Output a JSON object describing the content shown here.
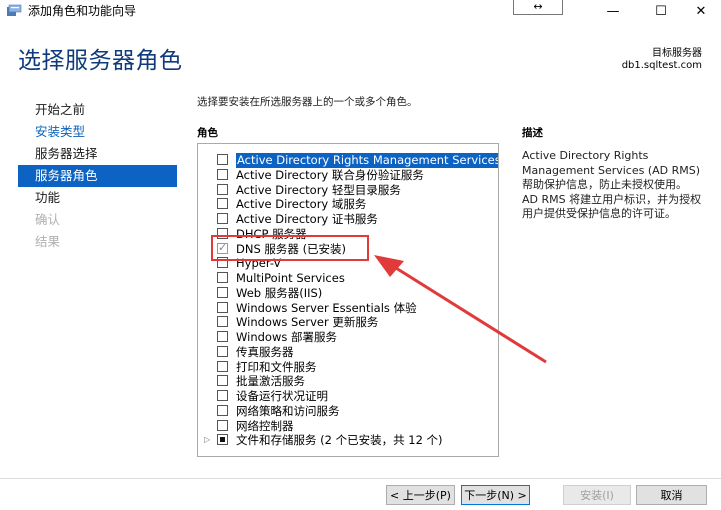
{
  "window": {
    "title": "添加角色和功能向导",
    "resize_glyph": "↔",
    "minimize_glyph": "—",
    "maximize_glyph": "☐",
    "close_glyph": "✕"
  },
  "header": {
    "title": "选择服务器角色",
    "target_label": "目标服务器",
    "target_server": "db1.sqltest.com"
  },
  "nav": {
    "items": [
      {
        "label": "开始之前",
        "state": "done"
      },
      {
        "label": "安装类型",
        "state": "link"
      },
      {
        "label": "服务器选择",
        "state": "done"
      },
      {
        "label": "服务器角色",
        "state": "active"
      },
      {
        "label": "功能",
        "state": "done"
      },
      {
        "label": "确认",
        "state": "disabled"
      },
      {
        "label": "结果",
        "state": "disabled"
      }
    ]
  },
  "content": {
    "instruction": "选择要安装在所选服务器上的一个或多个角色。",
    "roles_heading": "角色",
    "description_heading": "描述",
    "description": "Active Directory Rights Management Services (AD RMS) 帮助保护信息，防止未授权使用。AD RMS 将建立用户标识，并为授权用户提供受保护信息的许可证。"
  },
  "roles": [
    {
      "label": "Active Directory Rights Management Services",
      "checked": false,
      "selected": true
    },
    {
      "label": "Active Directory 联合身份验证服务",
      "checked": false
    },
    {
      "label": "Active Directory 轻型目录服务",
      "checked": false
    },
    {
      "label": "Active Directory 域服务",
      "checked": false
    },
    {
      "label": "Active Directory 证书服务",
      "checked": false
    },
    {
      "label": "DHCP 服务器",
      "checked": false
    },
    {
      "label": "DNS 服务器 (已安装)",
      "checked": true
    },
    {
      "label": "Hyper-V",
      "checked": false
    },
    {
      "label": "MultiPoint Services",
      "checked": false
    },
    {
      "label": "Web 服务器(IIS)",
      "checked": false
    },
    {
      "label": "Windows Server Essentials 体验",
      "checked": false
    },
    {
      "label": "Windows Server 更新服务",
      "checked": false
    },
    {
      "label": "Windows 部署服务",
      "checked": false
    },
    {
      "label": "传真服务器",
      "checked": false
    },
    {
      "label": "打印和文件服务",
      "checked": false
    },
    {
      "label": "批量激活服务",
      "checked": false
    },
    {
      "label": "设备运行状况证明",
      "checked": false
    },
    {
      "label": "网络策略和访问服务",
      "checked": false
    },
    {
      "label": "网络控制器",
      "checked": false
    },
    {
      "label": "文件和存储服务 (2 个已安装，共 12 个)",
      "checked": "partial",
      "expandable": true
    }
  ],
  "footer": {
    "prev": "< 上一步(P)",
    "next": "下一步(N) >",
    "install": "安装(I)",
    "cancel": "取消"
  },
  "colors": {
    "title_blue": "#0f3a7c",
    "selection_blue": "#0c63c3",
    "annotation_red": "#e03a3a"
  }
}
